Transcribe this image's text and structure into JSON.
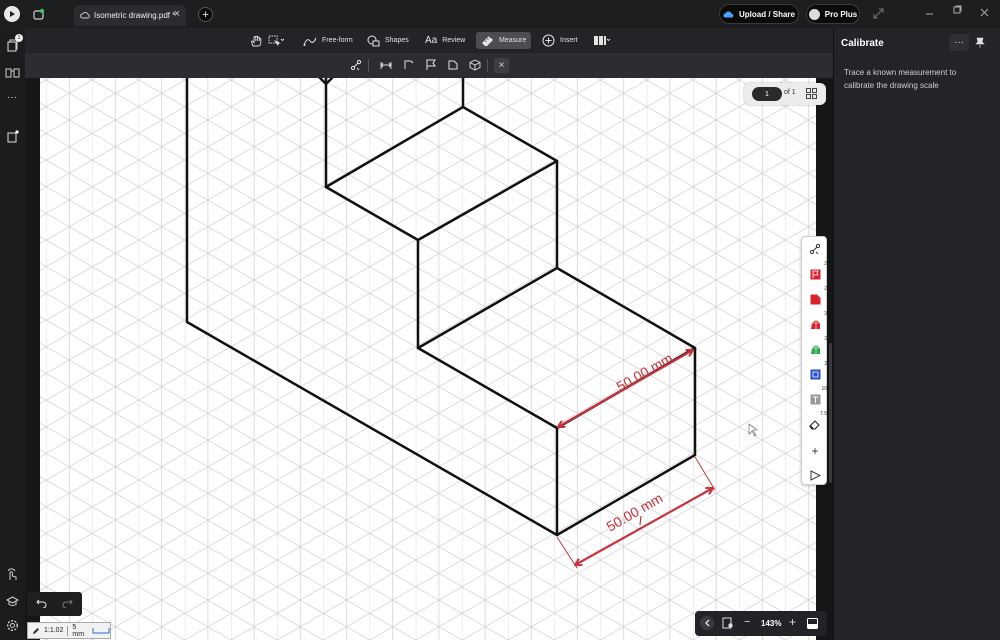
{
  "window": {
    "tab_title": "Isometric drawing.pdf *",
    "tab_close": "×",
    "new_tab": "+",
    "notification_count": "1",
    "upload_label": "Upload / Share",
    "plan_label": "Pro Plus"
  },
  "toolbar": {
    "tools": [
      {
        "name": "pan",
        "label": ""
      },
      {
        "name": "select",
        "label": ""
      },
      {
        "name": "free-form",
        "label": "Free-form"
      },
      {
        "name": "shapes",
        "label": "Shapes"
      },
      {
        "name": "review",
        "label": "Review"
      },
      {
        "name": "measure",
        "label": "Measure",
        "active": true
      },
      {
        "name": "insert",
        "label": "Insert"
      }
    ],
    "subtools_close": "×"
  },
  "panel": {
    "title": "Calibrate",
    "description": "Trace a known measurement to calibrate the drawing scale"
  },
  "page_indicator": {
    "current": "1",
    "total": "of 1"
  },
  "drawing": {
    "dimension_1": "50.00 mm",
    "dimension_2": "50.00 mm",
    "line_color": "#111111",
    "dimension_color": "#c8323c",
    "grid_color": "#c9c9c9"
  },
  "palette": {
    "badges": [
      "",
      "2",
      "2",
      "3",
      "3",
      "3",
      "10",
      "7.5",
      "",
      ""
    ]
  },
  "status": {
    "scale_ratio": "1:1.02",
    "grid_size": "5 mm",
    "zoom": "143%",
    "zoom_out": "−",
    "zoom_in": "+"
  },
  "colors": {
    "accent": "#c8323c",
    "toolbar_bg": "#232427",
    "panel_bg": "#232427"
  }
}
